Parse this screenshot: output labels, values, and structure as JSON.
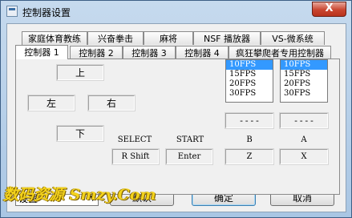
{
  "window": {
    "title": "控制器设置",
    "close_glyph": "X"
  },
  "tabs": {
    "row_back": [
      "家庭体育教练",
      "兴奋拳击",
      "麻将",
      "NSF 播放器",
      "VS-微系统"
    ],
    "row_front": [
      "控制器 1",
      "控制器 2",
      "控制器 3",
      "控制器 4",
      "疯狂攀爬者专用控制器"
    ],
    "active": "控制器 1"
  },
  "dpad": {
    "up": "上",
    "left": "左",
    "right": "右",
    "down": "下"
  },
  "keys": {
    "select_label": "SELECT",
    "select_value": "R Shift",
    "start_label": "START",
    "start_value": "Enter",
    "b_label": "B",
    "b_value": "Z",
    "a_label": "A",
    "a_value": "X"
  },
  "turbo": {
    "b_options": [
      "10FPS",
      "15FPS",
      "20FPS",
      "30FPS"
    ],
    "a_options": [
      "10FPS",
      "15FPS",
      "20FPS",
      "30FPS"
    ],
    "b_selected": "10FPS",
    "a_selected": "10FPS",
    "b_key": "----",
    "a_key": "----"
  },
  "bottom": {
    "preset_value": "设置",
    "default_button": "默认",
    "ok_button": "确定",
    "cancel_button": "取消"
  },
  "watermark": "数码资源 Smzy.Com",
  "colors": {
    "accent": "#3399ff",
    "close": "#c9452f",
    "watermark": "#f3d21c"
  }
}
